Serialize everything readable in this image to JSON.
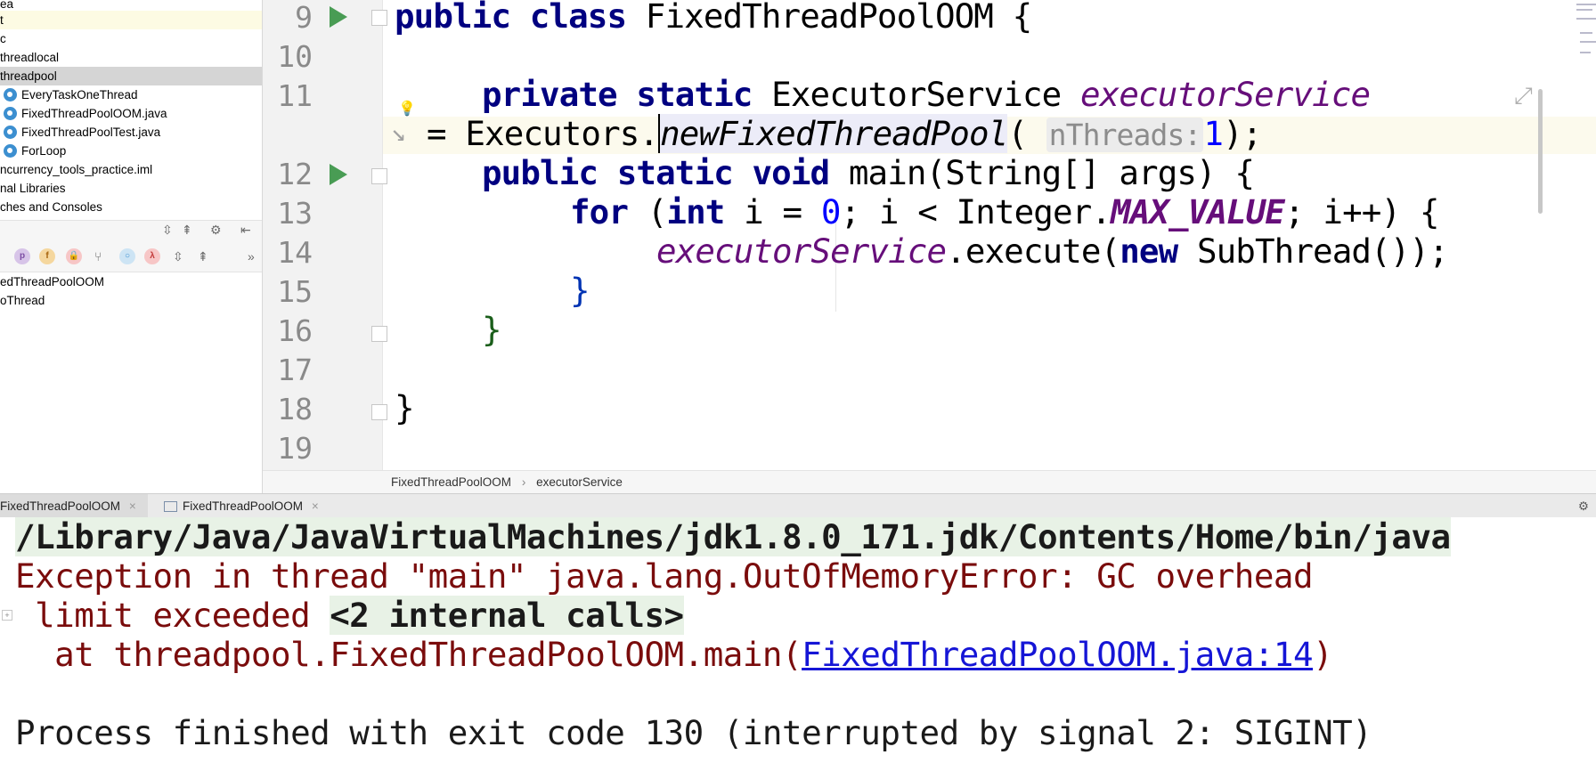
{
  "project_tree": {
    "items": [
      {
        "label": "ea"
      },
      {
        "label": "t"
      },
      {
        "label": "c"
      },
      {
        "label": "threadlocal"
      },
      {
        "label": "threadpool"
      },
      {
        "label": "EveryTaskOneThread"
      },
      {
        "label": "FixedThreadPoolOOM.java"
      },
      {
        "label": "FixedThreadPoolTest.java"
      },
      {
        "label": "ForLoop"
      },
      {
        "label": "ncurrency_tools_practice.iml"
      },
      {
        "label": "nal Libraries"
      },
      {
        "label": "ches and Consoles"
      }
    ]
  },
  "structure": {
    "items": [
      {
        "label": "edThreadPoolOOM"
      },
      {
        "label": "oThread"
      }
    ],
    "toolbar_more": "»"
  },
  "editor": {
    "lines": [
      {
        "num": "9"
      },
      {
        "num": "10"
      },
      {
        "num": "11"
      },
      {
        "num": "12"
      },
      {
        "num": "13"
      },
      {
        "num": "14"
      },
      {
        "num": "15"
      },
      {
        "num": "16"
      },
      {
        "num": "17"
      },
      {
        "num": "18"
      },
      {
        "num": "19"
      }
    ],
    "code": {
      "l9_kw": "public class",
      "l9_rest": " FixedThreadPoolOOM {",
      "l11_kw": "private static",
      "l11_type": " ExecutorService ",
      "l11_field": "executorService",
      "l11b_eq": "= Executors.",
      "l11b_method": "newFixedThreadPool",
      "l11b_paren": "( ",
      "l11b_hint": "nThreads:",
      "l11b_num": "1",
      "l11b_end": ");",
      "l12_kw": "public static void",
      "l12_rest": " main(String[] args) {",
      "l13_kw1": "for",
      "l13_a": " (",
      "l13_kw2": "int",
      "l13_b": " i = ",
      "l13_num": "0",
      "l13_c": "; i < Integer.",
      "l13_const": "MAX_VALUE",
      "l13_d": "; i++) {",
      "l14_field": "executorService",
      "l14_a": ".execute(",
      "l14_kw": "new",
      "l14_b": " SubThread());",
      "l15": "}",
      "l16": "}",
      "l18": "}"
    }
  },
  "breadcrumb": {
    "class": "FixedThreadPoolOOM",
    "sep": "›",
    "member": "executorService"
  },
  "run_tabs": [
    {
      "label": "FixedThreadPoolOOM"
    },
    {
      "label": "FixedThreadPoolOOM"
    }
  ],
  "console": {
    "path": "/Library/Java/JavaVirtualMachines/jdk1.8.0_171.jdk/Contents/Home/bin/java",
    "exception_1": "Exception in thread \"main\" java.lang.OutOfMemoryError: GC overhead",
    "exception_2": " limit exceeded ",
    "internal_calls": "<2 internal calls>",
    "at_prefix": "  at threadpool.FixedThreadPoolOOM.main(",
    "link": "FixedThreadPoolOOM.java:14",
    "at_suffix": ")",
    "exit": "Process finished with exit code 130 (interrupted by signal 2: SIGINT)"
  },
  "colors": {
    "keyword": "#000080",
    "field": "#660e7a",
    "error": "#7a0c0c",
    "link": "#1515d6",
    "run_icon": "#499c54"
  }
}
